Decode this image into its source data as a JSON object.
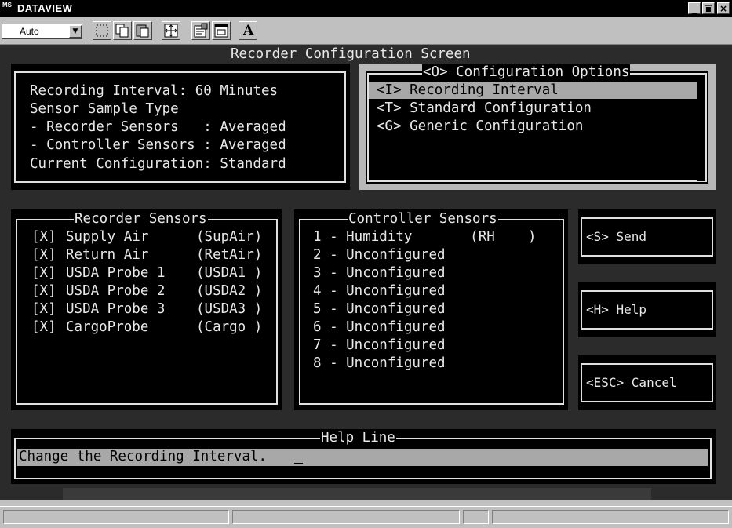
{
  "window": {
    "app_icon": "MS",
    "title": "DATAVIEW",
    "controls": {
      "minimize": "_",
      "restore": "▣",
      "close": "×"
    }
  },
  "toolbar": {
    "font_select": "Auto",
    "buttons": [
      "mark-icon",
      "copy-icon",
      "paste-icon",
      "fullscreen-icon",
      "properties-icon",
      "background-icon",
      "font-icon"
    ],
    "font_button": "A"
  },
  "screen": {
    "title": "Recorder Configuration Screen",
    "status": {
      "line1": "Recording Interval: 60 Minutes",
      "line2": "Sensor Sample Type",
      "line3": "- Recorder Sensors   : Averaged",
      "line4": "- Controller Sensors : Averaged",
      "line5": "Current Configuration: Standard"
    },
    "options": {
      "title": "<O> Configuration Options",
      "items": [
        "<I> Recording Interval",
        "<T> Standard Configuration",
        "<G> Generic Configuration"
      ]
    },
    "recorder_sensors": {
      "title": "Recorder Sensors",
      "items": [
        {
          "check": "[X]",
          "name": "Supply Air",
          "tag": "(SupAir)"
        },
        {
          "check": "[X]",
          "name": "Return Air",
          "tag": "(RetAir)"
        },
        {
          "check": "[X]",
          "name": "USDA Probe 1",
          "tag": "(USDA1 )"
        },
        {
          "check": "[X]",
          "name": "USDA Probe 2",
          "tag": "(USDA2 )"
        },
        {
          "check": "[X]",
          "name": "USDA Probe 3",
          "tag": "(USDA3 )"
        },
        {
          "check": "[X]",
          "name": "CargoProbe",
          "tag": "(Cargo )"
        }
      ]
    },
    "controller_sensors": {
      "title": "Controller Sensors",
      "items": [
        "1 - Humidity       (RH    )",
        "2 - Unconfigured",
        "3 - Unconfigured",
        "4 - Unconfigured",
        "5 - Unconfigured",
        "6 - Unconfigured",
        "7 - Unconfigured",
        "8 - Unconfigured"
      ]
    },
    "buttons": {
      "send": "<S> Send",
      "help": "<H> Help",
      "cancel": "<ESC> Cancel"
    },
    "help_line": {
      "title": "Help Line",
      "text": "Change the Recording Interval."
    }
  },
  "colors": {
    "console_bg": "#2b2b2b",
    "panel_bg": "#000000",
    "text": "#e8e8e8",
    "highlight_bg": "#a8a8a8",
    "chrome": "#c0c0c0"
  }
}
